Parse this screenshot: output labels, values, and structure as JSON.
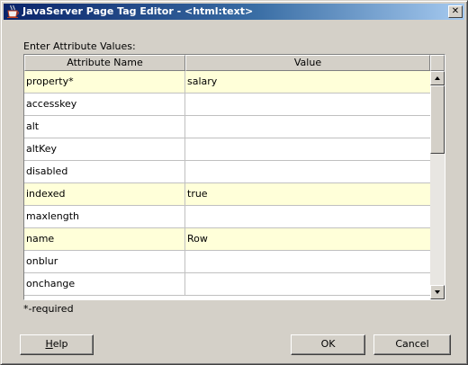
{
  "window": {
    "title": "JavaServer Page Tag Editor - <html:text>",
    "close_glyph": "✕",
    "icon": "coffee-cup-icon"
  },
  "prompt_label": "Enter Attribute Values:",
  "table": {
    "columns": [
      "Attribute Name",
      "Value"
    ],
    "highlight_color": "#ffffd9",
    "rows": [
      {
        "name": "property*",
        "value": "salary",
        "highlighted": true
      },
      {
        "name": "accesskey",
        "value": "",
        "highlighted": false
      },
      {
        "name": "alt",
        "value": "",
        "highlighted": false
      },
      {
        "name": "altKey",
        "value": "",
        "highlighted": false
      },
      {
        "name": "disabled",
        "value": "",
        "highlighted": false
      },
      {
        "name": "indexed",
        "value": "true",
        "highlighted": true
      },
      {
        "name": "maxlength",
        "value": "",
        "highlighted": false
      },
      {
        "name": "name",
        "value": "Row",
        "highlighted": true
      },
      {
        "name": "onblur",
        "value": "",
        "highlighted": false
      },
      {
        "name": "onchange",
        "value": "",
        "highlighted": false
      }
    ]
  },
  "required_note": "*-required",
  "buttons": {
    "help": "Help",
    "ok": "OK",
    "cancel": "Cancel"
  }
}
